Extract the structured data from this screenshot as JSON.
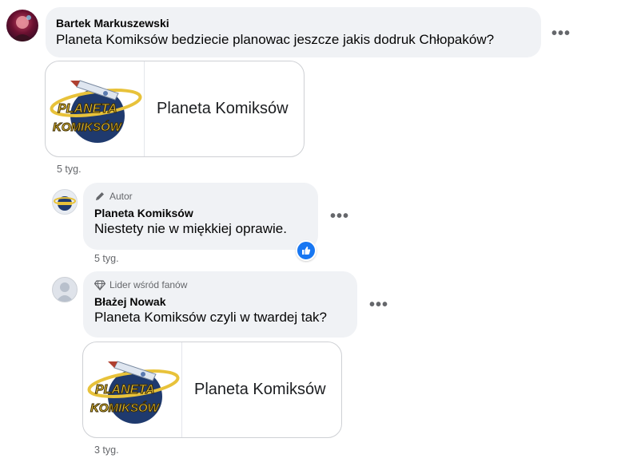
{
  "comments": [
    {
      "author": "Bartek Markuszewski",
      "text": "Planeta Komiksów bedziecie planowac jeszcze jakis dodruk Chłopaków?",
      "card_title": "Planeta Komiksów",
      "time": "5 tyg."
    },
    {
      "badge": "Autor",
      "author": "Planeta Komiksów",
      "text": "Niestety nie w miękkiej oprawie.",
      "time": "5 tyg."
    },
    {
      "badge": "Lider wśród fanów",
      "author": "Błażej Nowak",
      "text": "Planeta Komiksów czyli w twardej tak?",
      "card_title": "Planeta Komiksów",
      "time": "3 tyg."
    }
  ],
  "more_label": "•••",
  "logo": {
    "line1": "PLANETA",
    "line2": "KOMIKSÓW"
  },
  "colors": {
    "accent": "#1877f2",
    "bubble": "#f0f2f5",
    "meta": "#65676b",
    "logo_gold": "#e8c23a",
    "logo_blue": "#1f3a6e"
  }
}
